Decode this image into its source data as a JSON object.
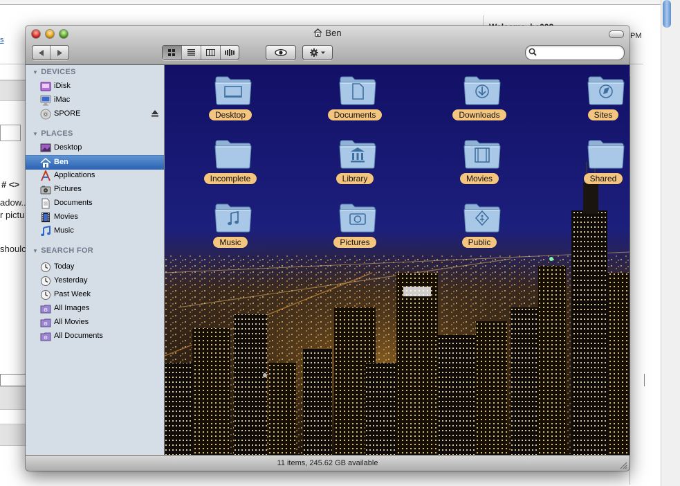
{
  "background": {
    "welcome_text": "Welcome, bc008",
    "side_fragment_pm": "PM",
    "side_fragment_ps": "ps",
    "left_fragments": [
      "s",
      "# <>",
      "adow...",
      "r pictu",
      "shoulc"
    ]
  },
  "window": {
    "title": "Ben",
    "status": "11 items, 245.62 GB available",
    "search_placeholder": ""
  },
  "sidebar": {
    "sections": [
      {
        "title": "DEVICES",
        "items": [
          {
            "label": "iDisk",
            "icon": "idisk-icon"
          },
          {
            "label": "iMac",
            "icon": "imac-icon"
          },
          {
            "label": "SPORE",
            "icon": "disc-icon"
          }
        ]
      },
      {
        "title": "PLACES",
        "items": [
          {
            "label": "Desktop",
            "icon": "desktop-icon"
          },
          {
            "label": "Ben",
            "icon": "home-icon"
          },
          {
            "label": "Applications",
            "icon": "applications-icon"
          },
          {
            "label": "Pictures",
            "icon": "pictures-icon"
          },
          {
            "label": "Documents",
            "icon": "documents-icon"
          },
          {
            "label": "Movies",
            "icon": "movies-icon"
          },
          {
            "label": "Music",
            "icon": "music-icon"
          }
        ]
      },
      {
        "title": "SEARCH FOR",
        "items": [
          {
            "label": "Today",
            "icon": "clock-icon"
          },
          {
            "label": "Yesterday",
            "icon": "clock-icon"
          },
          {
            "label": "Past Week",
            "icon": "clock-icon"
          },
          {
            "label": "All Images",
            "icon": "smart-folder-icon"
          },
          {
            "label": "All Movies",
            "icon": "smart-folder-icon"
          },
          {
            "label": "All Documents",
            "icon": "smart-folder-icon"
          }
        ]
      }
    ],
    "selected": "Ben"
  },
  "folders": [
    {
      "label": "Desktop",
      "icon": "desktop-folder-icon"
    },
    {
      "label": "Documents",
      "icon": "documents-folder-icon"
    },
    {
      "label": "Downloads",
      "icon": "downloads-folder-icon"
    },
    {
      "label": "Sites",
      "icon": "sites-folder-icon"
    },
    {
      "label": "Incomplete",
      "icon": "folder-icon"
    },
    {
      "label": "Library",
      "icon": "library-folder-icon"
    },
    {
      "label": "Movies",
      "icon": "movies-folder-icon"
    },
    {
      "label": "Shared",
      "icon": "shared-folder-icon"
    },
    {
      "label": "Music",
      "icon": "music-folder-icon"
    },
    {
      "label": "Pictures",
      "icon": "pictures-folder-icon"
    },
    {
      "label": "Public",
      "icon": "public-folder-icon"
    }
  ],
  "colors": {
    "label_bg": "#f4c57f",
    "sidebar_bg": "#d5dde6",
    "selection": "#2b62b3",
    "night_sky": "#15146a"
  }
}
